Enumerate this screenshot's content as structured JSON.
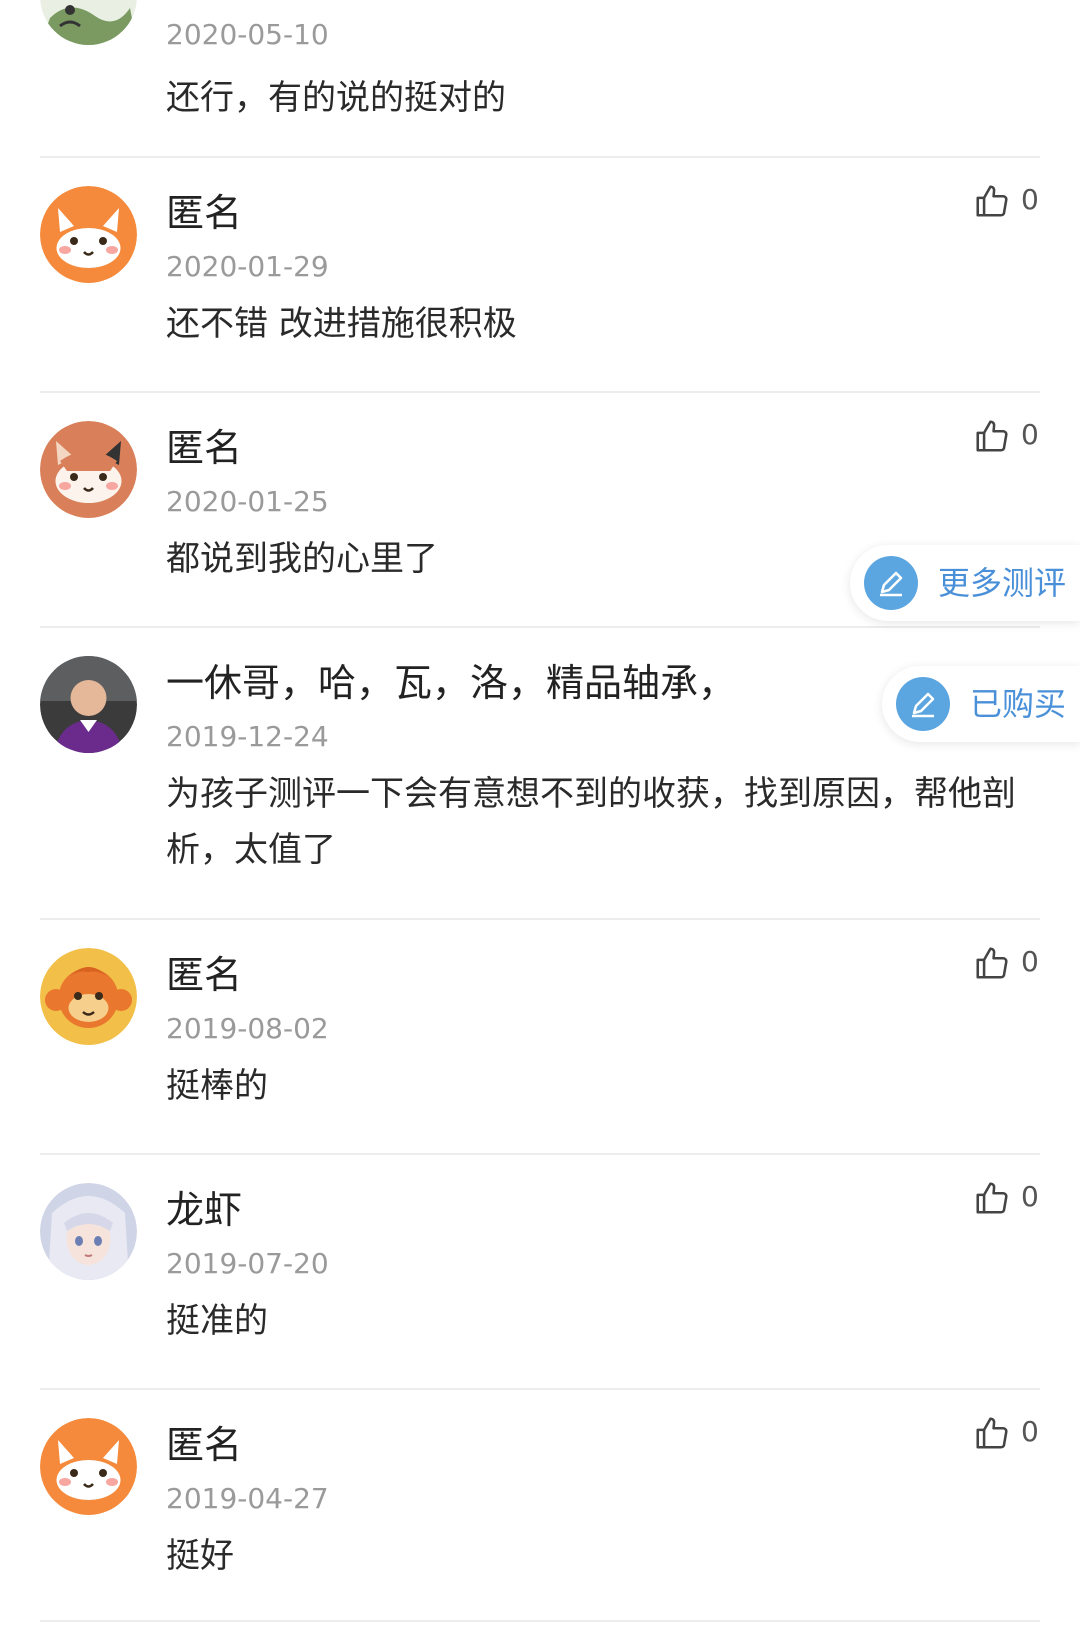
{
  "comments": [
    {
      "name": "",
      "date": "2020-05-10",
      "text": "还行，有的说的挺对的",
      "likes": ""
    },
    {
      "name": "匿名",
      "date": "2020-01-29",
      "text": "还不错 改进措施很积极",
      "likes": "0"
    },
    {
      "name": "匿名",
      "date": "2020-01-25",
      "text": "都说到我的心里了",
      "likes": "0"
    },
    {
      "name": "一休哥，哈，瓦，洛，精品轴承，",
      "date": "2019-12-24",
      "text": "为孩子测评一下会有意想不到的收获，找到原因，帮他剖析，太值了",
      "likes": ""
    },
    {
      "name": "匿名",
      "date": "2019-08-02",
      "text": "挺棒的",
      "likes": "0"
    },
    {
      "name": "龙虾",
      "date": "2019-07-20",
      "text": "挺准的",
      "likes": "0"
    },
    {
      "name": "匿名",
      "date": "2019-04-27",
      "text": "挺好",
      "likes": "0"
    }
  ],
  "floating": {
    "more_reviews": "更多测评",
    "purchased": "已购买"
  },
  "icons": {
    "like": "thumbs-up-icon",
    "edit": "pencil-icon"
  },
  "colors": {
    "accent": "#5ba6e0",
    "accent_text": "#4a90d9",
    "date": "#9a9a9a"
  }
}
